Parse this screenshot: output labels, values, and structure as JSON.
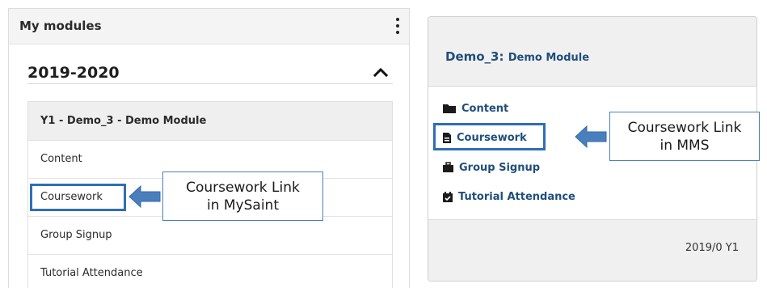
{
  "mysaint": {
    "header_title": "My modules",
    "year": "2019-2020",
    "module_title": "Y1 - Demo_3 - Demo Module",
    "items": [
      {
        "label": "Content"
      },
      {
        "label": "Coursework"
      },
      {
        "label": "Group Signup"
      },
      {
        "label": "Tutorial Attendance"
      }
    ],
    "icons": {
      "menu": "kebab-menu-icon",
      "collapse": "chevron-up-icon"
    }
  },
  "mms": {
    "title_code": "Demo_3:",
    "title_name": "Demo Module",
    "links": [
      {
        "label": "Content",
        "icon": "folder-icon"
      },
      {
        "label": "Coursework",
        "icon": "document-icon"
      },
      {
        "label": "Group Signup",
        "icon": "briefcase-icon"
      },
      {
        "label": "Tutorial Attendance",
        "icon": "calendar-check-icon"
      }
    ],
    "footer": "2019/0 Y1"
  },
  "annotations": {
    "mysaint_callout": [
      "Coursework Link",
      "in MySaint"
    ],
    "mms_callout": [
      "Coursework Link",
      "in MMS"
    ]
  },
  "colors": {
    "highlight_border": "#2f6eb5",
    "arrow_fill": "#4a7fbe",
    "mms_link": "#1f4e7c"
  }
}
